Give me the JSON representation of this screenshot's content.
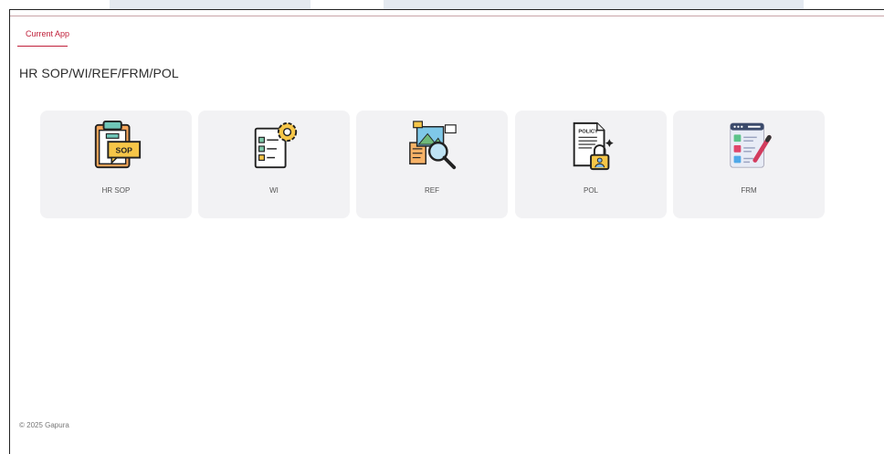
{
  "nav": {
    "current_tab": "Current App"
  },
  "page": {
    "title": "HR SOP/WI/REF/FRM/POL"
  },
  "cards": [
    {
      "label": "HR SOP",
      "icon": "clipboard-sop-icon",
      "badge": "SOP"
    },
    {
      "label": "WI",
      "icon": "checklist-gear-icon"
    },
    {
      "label": "REF",
      "icon": "image-magnifier-icon"
    },
    {
      "label": "POL",
      "icon": "policy-lock-icon",
      "badge": "POLICY"
    },
    {
      "label": "FRM",
      "icon": "form-pencil-icon"
    }
  ],
  "footer": {
    "copyright": "© 2025 Gapura"
  },
  "colors": {
    "accent": "#c0203a",
    "card_bg": "#f2f2f4",
    "band": "#e4e9f0"
  }
}
